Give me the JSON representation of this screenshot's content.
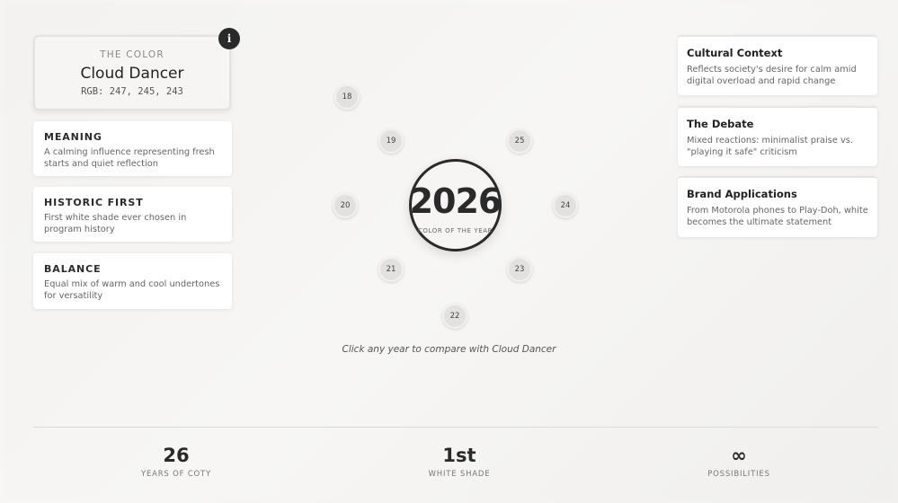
{
  "color_card": {
    "eyebrow": "THE COLOR",
    "name": "Cloud Dancer",
    "rgb": "RGB: 247, 245, 243"
  },
  "info_button": {
    "label": "i"
  },
  "left_cards": [
    {
      "title": "MEANING",
      "text": "A calming influence representing fresh starts and quiet reflection"
    },
    {
      "title": "HISTORIC FIRST",
      "text": "First white shade ever chosen in program history"
    },
    {
      "title": "BALANCE",
      "text": "Equal mix of warm and cool undertones for versatility"
    }
  ],
  "right_cards": [
    {
      "title": "Cultural Context",
      "text": "Reflects society's desire for calm amid digital overload and rapid change"
    },
    {
      "title": "The Debate",
      "text": "Mixed reactions: minimalist praise vs. \"playing it safe\" criticism"
    },
    {
      "title": "Brand Applications",
      "text": "From Motorola phones to Play-Doh, white becomes the ultimate statement"
    }
  ],
  "wheel": {
    "center_year": "2026",
    "center_subtitle": "COLOR OF THE YEAR",
    "years": [
      "18",
      "19",
      "20",
      "21",
      "22",
      "23",
      "24",
      "25"
    ],
    "hint": "Click any year to compare with Cloud Dancer"
  },
  "stats": [
    {
      "value": "26",
      "label": "YEARS OF COTY"
    },
    {
      "value": "1st",
      "label": "WHITE SHADE"
    },
    {
      "value": "∞",
      "label": "POSSIBILITIES"
    }
  ],
  "colors": {
    "accent": "#2a2a2a",
    "cloud_dancer": "#f7f5f3",
    "node": "#e2e1df"
  }
}
